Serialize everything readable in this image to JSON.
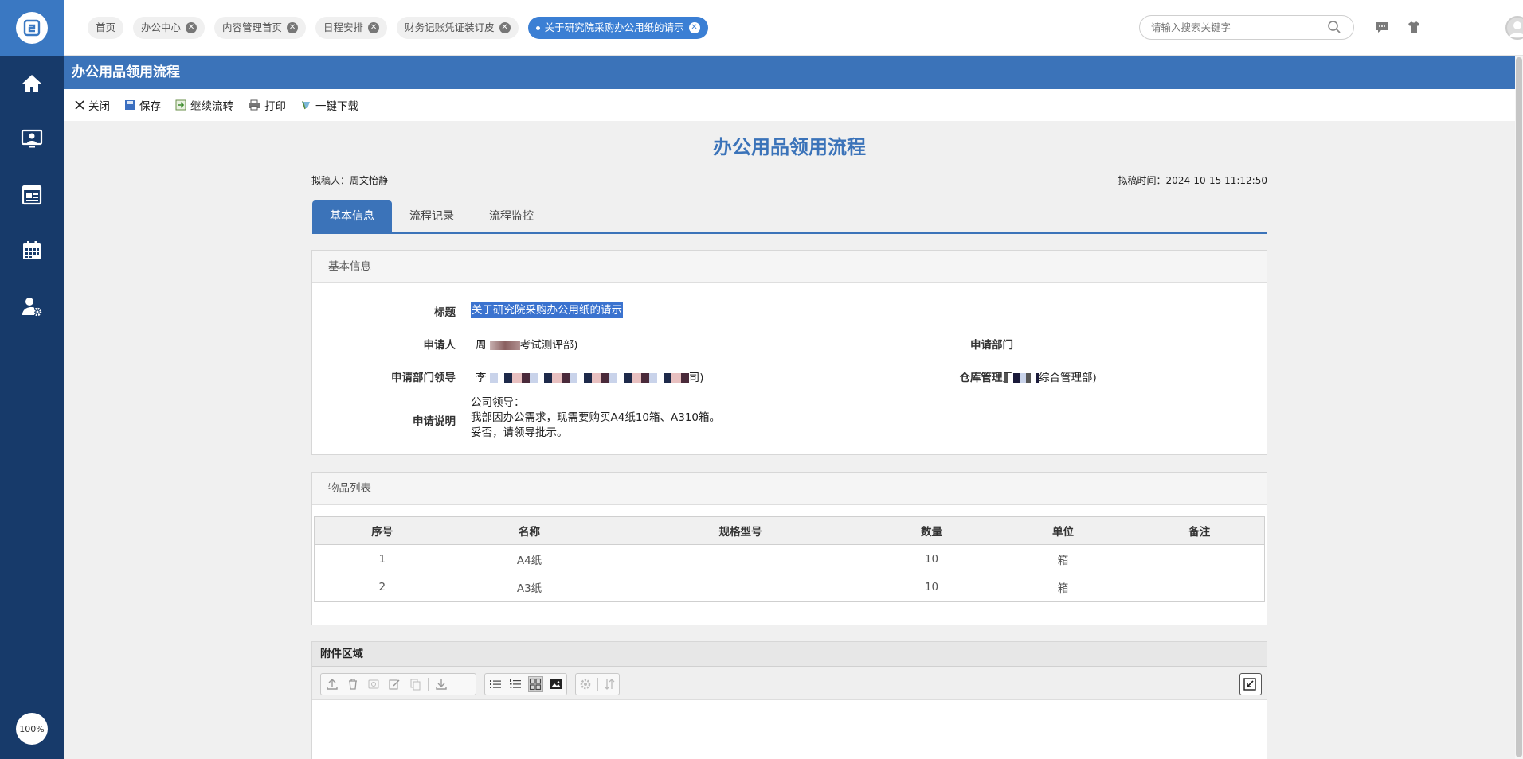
{
  "sidebar": {
    "zoom": "100%",
    "items": [
      {
        "name": "home-icon"
      },
      {
        "name": "user-monitor-icon"
      },
      {
        "name": "dashboard-icon"
      },
      {
        "name": "calendar-icon"
      },
      {
        "name": "user-settings-icon"
      }
    ]
  },
  "topbar": {
    "tabs": [
      {
        "label": "首页",
        "closable": false
      },
      {
        "label": "办公中心",
        "closable": true
      },
      {
        "label": "内容管理首页",
        "closable": true
      },
      {
        "label": "日程安排",
        "closable": true
      },
      {
        "label": "财务记账凭证装订皮",
        "closable": true
      },
      {
        "label": "关于研究院采购办公用纸的请示",
        "closable": true,
        "active": true
      }
    ],
    "search_placeholder": "请输入搜索关键字"
  },
  "page": {
    "title": "办公用品领用流程",
    "toolbar": {
      "close": "关闭",
      "save": "保存",
      "continue": "继续流转",
      "print": "打印",
      "download": "一键下载"
    },
    "doc_title": "办公用品领用流程",
    "drafter_label": "拟稿人：",
    "drafter": "周文怡静",
    "draft_time_label": "拟稿时间：",
    "draft_time": "2024-10-15 11:12:50",
    "tabs": [
      "基本信息",
      "流程记录",
      "流程监控"
    ]
  },
  "basic_info": {
    "header": "基本信息",
    "title_label": "标题",
    "title_value": "关于研究院采购办公用纸的请示",
    "applicant_label": "申请人",
    "applicant_prefix": "周",
    "applicant_suffix": "考试测评部)",
    "dept_label": "申请部门",
    "dept_leader_label": "申请部门领导",
    "dept_leader_prefix": "李",
    "dept_leader_suffix": "司)",
    "warehouse_label": "仓库管理员",
    "warehouse_suffix": "综合管理部)",
    "desc_label": "申请说明",
    "desc_lines": [
      "公司领导：",
      "我部因办公需求，现需要购买A4纸10箱、A310箱。",
      "妥否，请领导批示。"
    ]
  },
  "items": {
    "header": "物品列表",
    "columns": [
      "序号",
      "名称",
      "规格型号",
      "数量",
      "单位",
      "备注"
    ],
    "rows": [
      [
        "1",
        "A4纸",
        "",
        "10",
        "箱",
        ""
      ],
      [
        "2",
        "A3纸",
        "",
        "10",
        "箱",
        ""
      ]
    ]
  },
  "attachments": {
    "header": "附件区域"
  }
}
